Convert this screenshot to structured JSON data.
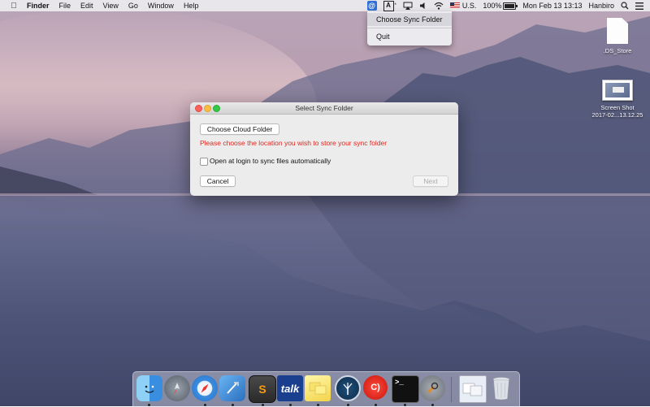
{
  "menubar": {
    "app_name": "Finder",
    "menus": [
      "File",
      "Edit",
      "View",
      "Go",
      "Window",
      "Help"
    ],
    "status": {
      "input_source": "U.S.",
      "battery": "100%",
      "datetime": "Mon Feb 13  13:13",
      "user": "Hanbiro"
    }
  },
  "sync_menu": {
    "items": [
      "Choose Sync Folder",
      "Quit"
    ]
  },
  "dialog": {
    "title": "Select Sync Folder",
    "choose_button": "Choose Cloud Folder",
    "warning": "Please choose the location you wish to store your sync folder",
    "checkbox_label": "Open at login to sync files automatically",
    "checkbox_checked": false,
    "cancel_button": "Cancel",
    "next_button": "Next"
  },
  "desktop_icons": [
    {
      "label_line1": ".DS_Store",
      "label_line2": ""
    },
    {
      "label_line1": "Screen Shot",
      "label_line2": "2017-02...13.12.25"
    }
  ],
  "dock": {
    "apps": [
      "finder-icon",
      "launchpad-icon",
      "safari-icon",
      "xcode-icon",
      "sublime-text-icon",
      "talk-icon",
      "stickies-icon",
      "sourcetree-icon",
      "cloud-app-icon",
      "terminal-icon",
      "system-preferences-icon",
      "folder-stack-icon",
      "trash-icon"
    ],
    "talk_label": "talk",
    "terminal_label": ">_",
    "sublime_label": "S",
    "cloud_label": "C)"
  },
  "colors": {
    "warning_text": "#e0271f",
    "highlight": "#d6d6dc"
  }
}
